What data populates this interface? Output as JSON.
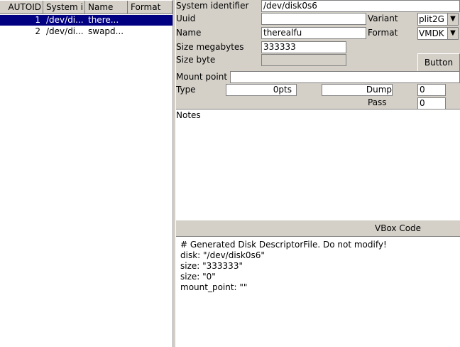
{
  "table": {
    "columns": [
      "AUTOID",
      "System i",
      "Name",
      "Format"
    ],
    "rows": [
      {
        "autoid": "1",
        "system": "/dev/di...",
        "name": "there...",
        "format": "",
        "selected": true
      },
      {
        "autoid": "2",
        "system": "/dev/di...",
        "name": "swapd...",
        "format": "",
        "selected": false
      }
    ]
  },
  "form": {
    "system_identifier_label": "System identifier",
    "system_identifier_value": "/dev/disk0s6",
    "uuid_label": "Uuid",
    "uuid_value": "",
    "variant_label": "Variant",
    "variant_value": "plit2G",
    "name_label": "Name",
    "name_value": "therealfu",
    "format_label": "Format",
    "format_value": "VMDK",
    "size_mb_label": "Size megabytes",
    "size_mb_value": "333333",
    "size_byte_label": "Size byte",
    "size_byte_value": "",
    "button_label": "Button",
    "mount_point_label": "Mount point",
    "mount_point_value": "",
    "type_label": "Type",
    "opts_value": "0pts",
    "dump_label": "Dump",
    "dump_value": "0",
    "pass_label": "Pass",
    "pass_value": "0",
    "notes_label": "Notes"
  },
  "code": {
    "header": "VBox Code",
    "lines": [
      "# Generated Disk DescriptorFile. Do not modify!",
      "disk: \"/dev/disk0s6\"",
      "size: \"333333\"",
      "size: \"0\"",
      "mount_point: \"\""
    ]
  }
}
